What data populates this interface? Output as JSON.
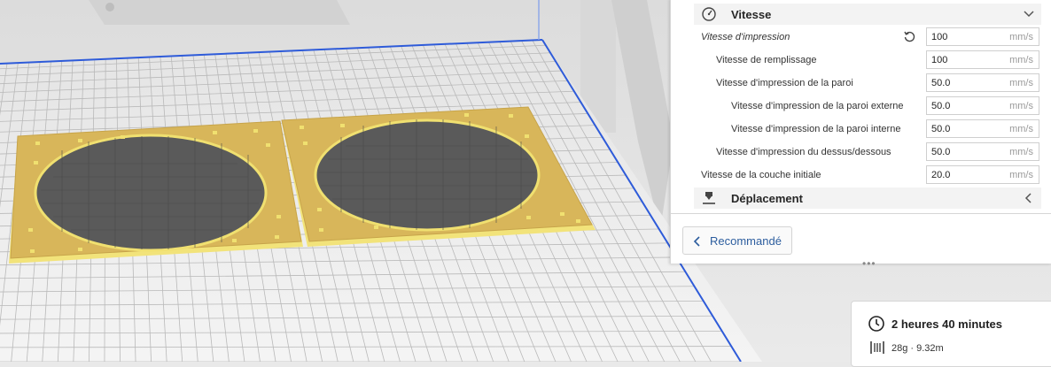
{
  "section_speed": {
    "title": "Vitesse",
    "icon": "speedometer-icon"
  },
  "speed_settings": [
    {
      "label": "Vitesse d'impression",
      "value": "100",
      "unit": "mm/s"
    },
    {
      "label": "Vitesse de remplissage",
      "value": "100",
      "unit": "mm/s"
    },
    {
      "label": "Vitesse d'impression de la paroi",
      "value": "50.0",
      "unit": "mm/s"
    },
    {
      "label": "Vitesse d'impression de la paroi externe",
      "value": "50.0",
      "unit": "mm/s"
    },
    {
      "label": "Vitesse d'impression de la paroi interne",
      "value": "50.0",
      "unit": "mm/s"
    },
    {
      "label": "Vitesse d'impression du dessus/dessous",
      "value": "50.0",
      "unit": "mm/s"
    },
    {
      "label": "Vitesse de la couche initiale",
      "value": "20.0",
      "unit": "mm/s"
    }
  ],
  "section_travel": {
    "title": "Déplacement",
    "icon": "nozzle-icon"
  },
  "recommended_button": {
    "label": "Recommandé"
  },
  "estimate": {
    "time": "2 heures 40 minutes",
    "material": "28g · 9.32m"
  },
  "colors": {
    "accent": "#2c5d9e",
    "model": "#d8b65a",
    "model_edge": "#f0e070",
    "grid_line": "#b9b9b9",
    "volume_edge": "#2e5bd9"
  }
}
